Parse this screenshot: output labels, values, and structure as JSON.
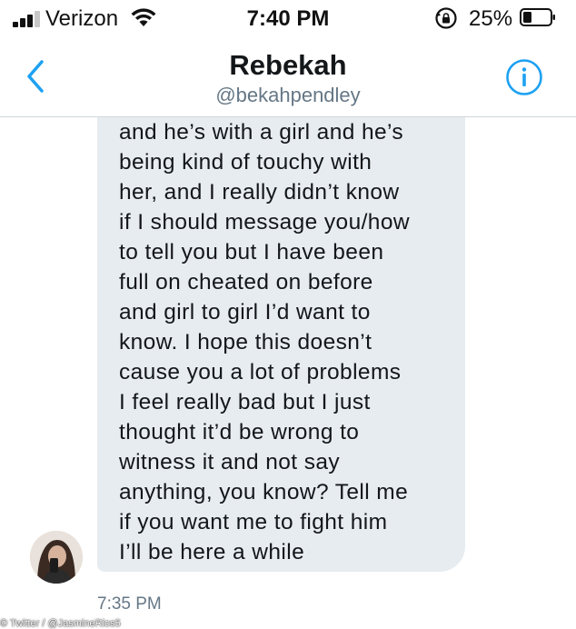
{
  "status_bar": {
    "carrier": "Verizon",
    "time": "7:40 PM",
    "battery_percent": "25%",
    "icons": [
      "signal-icon",
      "wifi-icon",
      "rotation-lock-icon",
      "battery-icon"
    ]
  },
  "header": {
    "back_icon": "chevron-left-icon",
    "name": "Rebekah",
    "handle": "@bekahpendley",
    "info_icon": "info-icon",
    "accent_color": "#1da1f2"
  },
  "message": {
    "text": "and he’s with a girl and he’s\nbeing kind of touchy with\nher, and I really didn’t know\nif I should message you/how\nto tell you but I have been\nfull on cheated on before\nand girl to girl I’d want to\nknow. I hope this doesn’t\ncause you a lot of problems\nI feel really bad but I just\nthought it’d be wrong to\nwitness it and not say\nanything, you know? Tell me\nif you want me to fight him\nI’ll be here a while",
    "timestamp": "7:35 PM",
    "bubble_color": "#e6ecf0"
  },
  "credit": "© Twitter / @JasmineRios5"
}
